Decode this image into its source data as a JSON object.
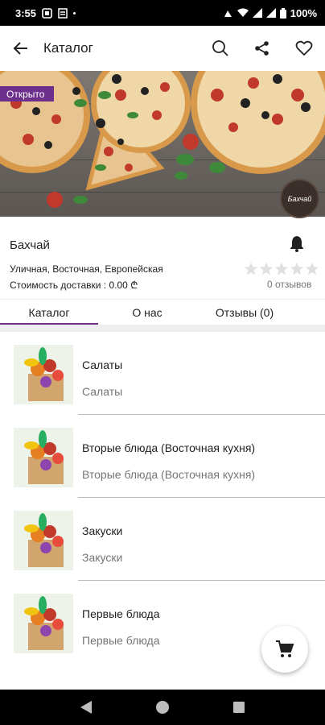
{
  "status_bar": {
    "time": "3:55",
    "battery": "100%"
  },
  "app_bar": {
    "title": "Каталог"
  },
  "hero": {
    "badge": "Открыто",
    "logo_text": "Бахчай"
  },
  "shop": {
    "name": "Бахчай",
    "cuisines": "Уличная, Восточная, Европейская",
    "delivery": "Стоимость доставки : 0.00 ₾",
    "rating": 0,
    "reviews": "0 отзывов"
  },
  "tabs": [
    {
      "label": "Каталог"
    },
    {
      "label": "О нас"
    },
    {
      "label": "Отзывы (0)"
    }
  ],
  "catalog": [
    {
      "title": "Салаты",
      "subtitle": "Салаты"
    },
    {
      "title": "Вторые блюда (Восточная кухня)",
      "subtitle": "Вторые блюда (Восточная кухня)"
    },
    {
      "title": "Закуски",
      "subtitle": "Закуски"
    },
    {
      "title": "Первые блюда",
      "subtitle": "Первые блюда"
    }
  ],
  "colors": {
    "accent": "#6d2f8c",
    "star": "#e0e0e0"
  },
  "icons": [
    "back-arrow-icon",
    "search-icon",
    "share-icon",
    "heart-icon",
    "bell-icon",
    "star-icon",
    "cart-icon"
  ]
}
